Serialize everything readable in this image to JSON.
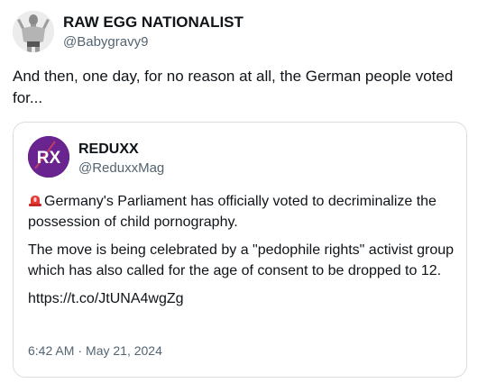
{
  "tweet": {
    "author_name": "RAW EGG NATIONALIST",
    "author_handle": "@Babygravy9",
    "text": "And then, one day, for no reason at all, the German people voted for..."
  },
  "quote": {
    "author_name": "REDUXX",
    "author_handle": "@ReduxxMag",
    "avatar_text": "RX",
    "paragraph1": "Germany's Parliament has officially voted to decriminalize the possession of child pornography.",
    "paragraph2": "The move is being celebrated by a \"pedophile rights\" activist group which has also called for the age of consent to be dropped to 12.",
    "link": "https://t.co/JtUNA4wgZg",
    "time": "6:42 AM",
    "separator": "·",
    "date": "May 21, 2024"
  },
  "icons": {
    "alarm": "rotating-light-emoji"
  },
  "colors": {
    "avatar_brand": "#6a2490",
    "muted_text": "#536471",
    "border": "#d9dde2"
  }
}
